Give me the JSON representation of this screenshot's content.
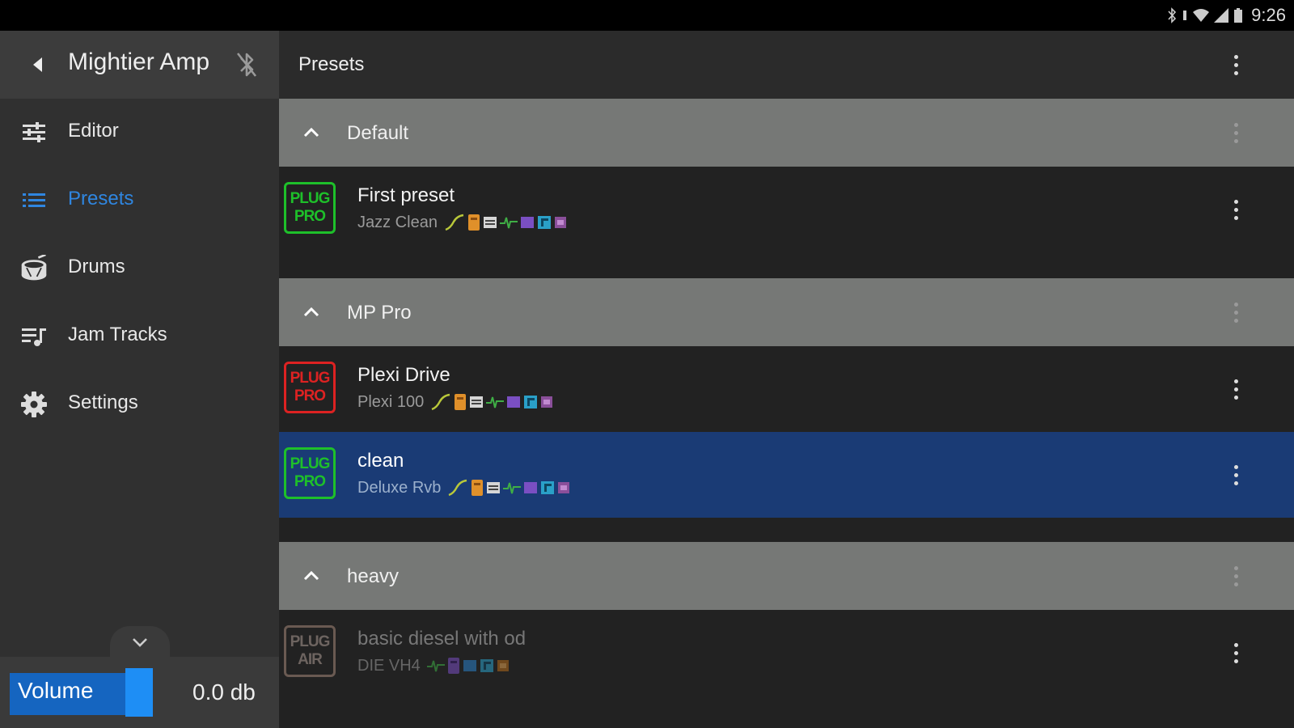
{
  "statusbar": {
    "time": "9:26"
  },
  "sidebar": {
    "app_title": "Mightier Amp",
    "items": [
      {
        "label": "Editor",
        "icon": "sliders-icon",
        "active": false
      },
      {
        "label": "Presets",
        "icon": "list-icon",
        "active": true
      },
      {
        "label": "Drums",
        "icon": "drum-icon",
        "active": false
      },
      {
        "label": "Jam Tracks",
        "icon": "playlist-music-icon",
        "active": false
      },
      {
        "label": "Settings",
        "icon": "gear-icon",
        "active": false
      }
    ],
    "volume": {
      "label": "Volume",
      "value": "0.0 db"
    }
  },
  "main": {
    "title": "Presets",
    "groups": [
      {
        "name": "Default",
        "presets": [
          {
            "name": "First preset",
            "amp": "Jazz Clean",
            "badge": [
              "PLUG",
              "PRO"
            ],
            "badge_color": "#1ec02a"
          }
        ]
      },
      {
        "name": "MP Pro",
        "presets": [
          {
            "name": "Plexi Drive",
            "amp": "Plexi 100",
            "badge": [
              "PLUG",
              "PRO"
            ],
            "badge_color": "#d22222"
          },
          {
            "name": "clean",
            "amp": "Deluxe Rvb",
            "badge": [
              "PLUG",
              "PRO"
            ],
            "badge_color": "#1ec02a",
            "selected": true
          }
        ]
      },
      {
        "name": "heavy",
        "presets": [
          {
            "name": "basic diesel with od",
            "amp": "DIE VH4",
            "badge": [
              "PLUG",
              "AIR"
            ],
            "badge_color": "#6a5a52"
          }
        ]
      }
    ]
  },
  "colors": {
    "accent": "#2f86e0",
    "selected_row": "#1a3b75",
    "group_header": "#767876"
  }
}
